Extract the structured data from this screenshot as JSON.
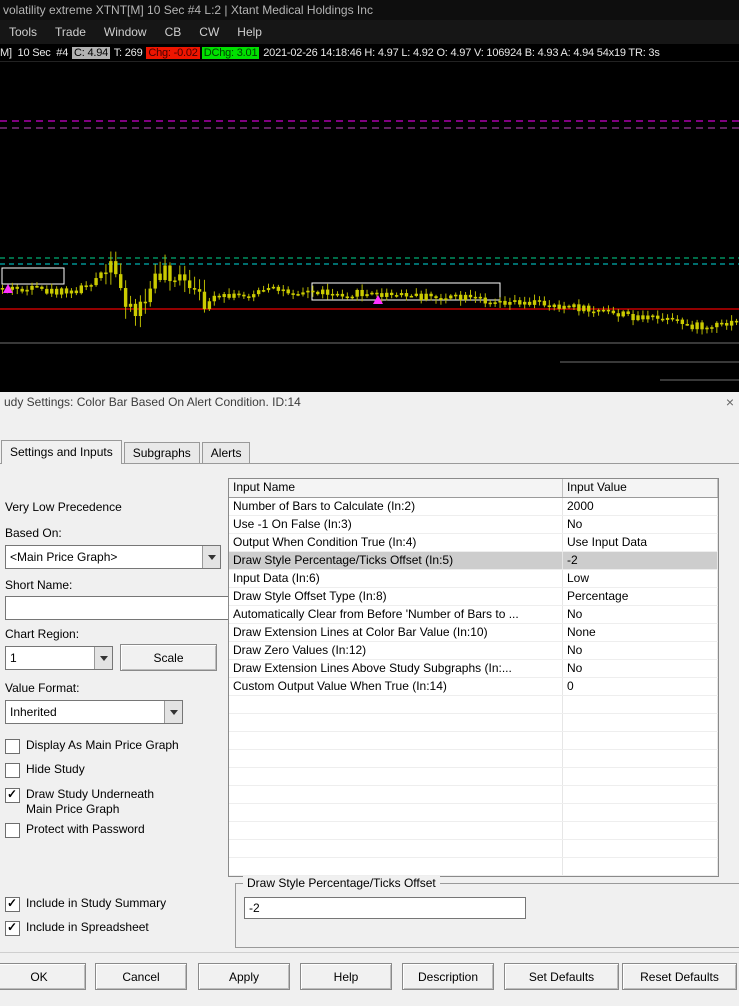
{
  "chart_window": {
    "title": "volatility extreme XTNT[M]  10 Sec   #4 L:2 | Xtant Medical Holdings Inc",
    "menu": [
      "Tools",
      "Trade",
      "Window",
      "CB",
      "CW",
      "Help"
    ],
    "status_segments": [
      {
        "name": "symbol-period",
        "text": "M]  10 Sec  #4 ",
        "fg": "#e8e8e8"
      },
      {
        "name": "last-price",
        "text": "C: 4.94",
        "bg": "#b2b2b2",
        "fg": "#000000"
      },
      {
        "name": "trade-count",
        "text": " T: 269 ",
        "fg": "#e8e8e8"
      },
      {
        "name": "change",
        "text": "Chg: -0.02",
        "bg": "#ee1500",
        "fg": "#450000"
      },
      {
        "name": "daily-change",
        "text": "DChg: 3.01",
        "bg": "#00e000",
        "fg": "#004000"
      },
      {
        "name": "session-info",
        "text": " 2021-02-26 14:18:46 H: 4.97 L: 4.92 O: 4.97 V: 106924 B: 4.93 A: 4.94 54x19 TR: 3s",
        "fg": "#e8e8e8"
      }
    ],
    "alert_indicator_color": "#d40000"
  },
  "chart_colors": {
    "magenta": "#ff00ff",
    "magenta_dim": "#c044c0",
    "teal": "#00d890",
    "cyan": "#00dcdc",
    "red": "#c40000",
    "gray": "#6f6f6f",
    "white": "#ffffff",
    "candle": "#cbcb00",
    "candle_wick": "#b9b900",
    "arrow": "#ff30ff"
  },
  "dialog": {
    "title": "udy Settings: Color Bar Based On Alert Condition. ID:14",
    "close_label": "×",
    "tabs": [
      {
        "label": "Settings and Inputs",
        "active": true
      },
      {
        "label": "Subgraphs",
        "active": false
      },
      {
        "label": "Alerts",
        "active": false
      }
    ],
    "left": {
      "precedence": "Very Low Precedence",
      "based_on_label": "Based On:",
      "based_on_value": "<Main Price Graph>",
      "short_name_label": "Short Name:",
      "short_name_value": "",
      "chart_region_label": "Chart Region:",
      "chart_region_value": "1",
      "scale_button": "Scale",
      "value_format_label": "Value Format:",
      "value_format_value": "Inherited",
      "checkboxes": [
        {
          "label": "Display As Main Price Graph",
          "checked": false
        },
        {
          "label": "Hide Study",
          "checked": false
        },
        {
          "label": "Draw Study Underneath\nMain Price Graph",
          "checked": true
        },
        {
          "label": "Protect with Password",
          "checked": false
        }
      ],
      "bottom_checkboxes": [
        {
          "label": "Include in Study Summary",
          "checked": true
        },
        {
          "label": "Include in Spreadsheet",
          "checked": true
        }
      ]
    },
    "table": {
      "columns": [
        "Input Name",
        "Input Value"
      ],
      "rows": [
        {
          "name": "Number of Bars to Calculate  (In:2)",
          "value": "2000",
          "selected": false
        },
        {
          "name": "Use -1 On False  (In:3)",
          "value": "No",
          "selected": false
        },
        {
          "name": "Output When Condition True  (In:4)",
          "value": "Use Input Data",
          "selected": false
        },
        {
          "name": "Draw Style Percentage/Ticks Offset  (In:5)",
          "value": "-2",
          "selected": true
        },
        {
          "name": "Input Data  (In:6)",
          "value": "Low",
          "selected": false
        },
        {
          "name": "Draw Style Offset Type  (In:8)",
          "value": "Percentage",
          "selected": false
        },
        {
          "name": "Automatically Clear from Before 'Number of Bars to ...",
          "value": "No",
          "selected": false
        },
        {
          "name": "Draw Extension Lines at Color Bar Value  (In:10)",
          "value": "None",
          "selected": false
        },
        {
          "name": "Draw Zero Values  (In:12)",
          "value": "No",
          "selected": false
        },
        {
          "name": "Draw Extension Lines Above Study Subgraphs  (In:...",
          "value": "No",
          "selected": false
        },
        {
          "name": "Custom Output Value When True  (In:14)",
          "value": "0",
          "selected": false
        }
      ],
      "empty_row_count": 12
    },
    "offset_group": {
      "legend": "Draw Style Percentage/Ticks Offset",
      "value": "-2"
    },
    "buttons": [
      "OK",
      "Cancel",
      "Apply",
      "Help",
      "Description",
      "Set Defaults",
      "Reset Defaults"
    ]
  }
}
